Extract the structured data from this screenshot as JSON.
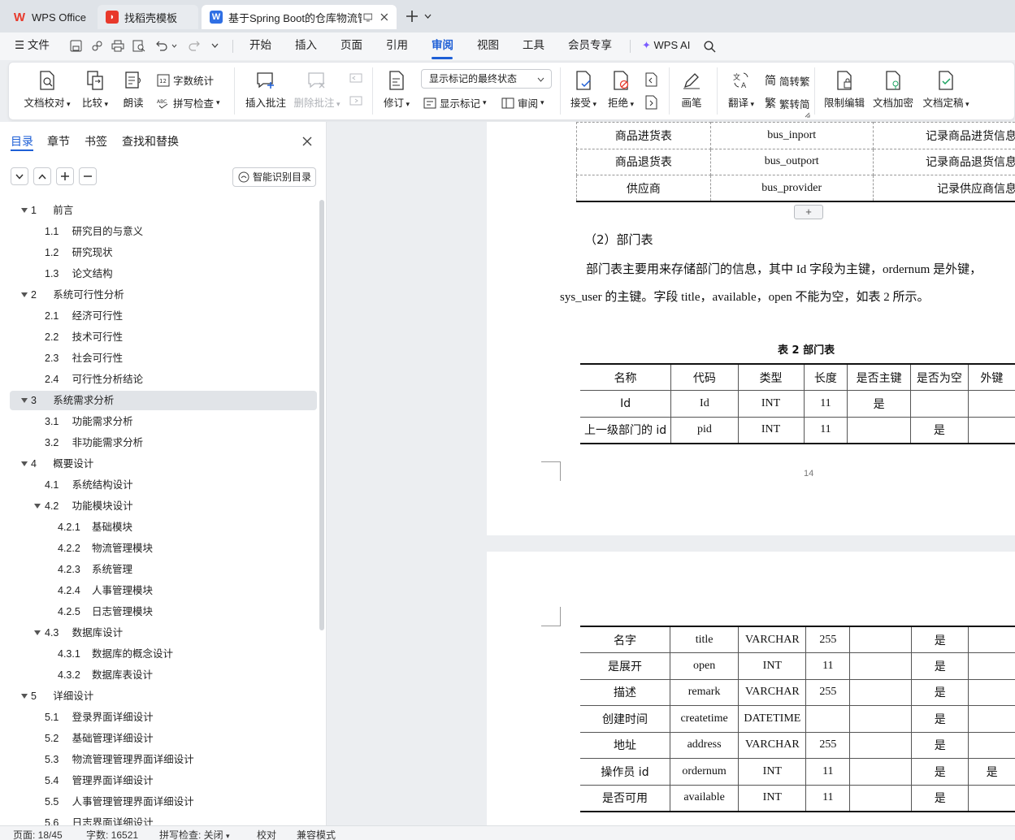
{
  "tabs": [
    {
      "label": "WPS Office",
      "icon": "wps-logo-icon"
    },
    {
      "label": "找稻壳模板",
      "icon": "docer-icon"
    },
    {
      "label": "基于Spring Boot的仓库物流管",
      "icon": "word-doc-icon"
    }
  ],
  "menu": {
    "file": "文件",
    "items": [
      "开始",
      "插入",
      "页面",
      "引用",
      "审阅",
      "视图",
      "工具",
      "会员专享"
    ],
    "active": "审阅",
    "ai": "WPS AI"
  },
  "ribbon": {
    "proof": "文档校对",
    "compare": "比较",
    "read": "朗读",
    "wordcount": "字数统计",
    "spellcheck": "拼写检查",
    "insert_comment": "插入批注",
    "delete_comment": "删除批注",
    "track": "修订",
    "display_state": "显示标记的最终状态",
    "show_markup": "显示标记",
    "review": "审阅",
    "accept": "接受",
    "reject": "拒绝",
    "pen": "画笔",
    "translate": "翻译",
    "to_traditional": "简转繁",
    "to_simplified": "繁转简",
    "restrict": "限制编辑",
    "encrypt": "文档加密",
    "finalize": "文档定稿"
  },
  "panel": {
    "tabs": [
      "目录",
      "章节",
      "书签",
      "查找和替换"
    ],
    "active_tab": "目录",
    "smart_toc": "智能识别目录",
    "toc": [
      {
        "num": "1",
        "title": "前言",
        "level": 1,
        "expanded": true
      },
      {
        "num": "1.1",
        "title": "研究目的与意义",
        "level": 2
      },
      {
        "num": "1.2",
        "title": "研究现状",
        "level": 2
      },
      {
        "num": "1.3",
        "title": "论文结构",
        "level": 2
      },
      {
        "num": "2",
        "title": "系统可行性分析",
        "level": 1,
        "expanded": true
      },
      {
        "num": "2.1",
        "title": "经济可行性",
        "level": 2
      },
      {
        "num": "2.2",
        "title": "技术可行性",
        "level": 2
      },
      {
        "num": "2.3",
        "title": "社会可行性",
        "level": 2
      },
      {
        "num": "2.4",
        "title": "可行性分析结论",
        "level": 2
      },
      {
        "num": "3",
        "title": "系统需求分析",
        "level": 1,
        "expanded": true,
        "selected": true
      },
      {
        "num": "3.1",
        "title": "功能需求分析",
        "level": 2
      },
      {
        "num": "3.2",
        "title": "非功能需求分析",
        "level": 2
      },
      {
        "num": "4",
        "title": "概要设计",
        "level": 1,
        "expanded": true
      },
      {
        "num": "4.1",
        "title": "系统结构设计",
        "level": 2
      },
      {
        "num": "4.2",
        "title": "功能模块设计",
        "level": 2,
        "expanded": true
      },
      {
        "num": "4.2.1",
        "title": "基础模块",
        "level": 3
      },
      {
        "num": "4.2.2",
        "title": "物流管理模块",
        "level": 3
      },
      {
        "num": "4.2.3",
        "title": "系统管理",
        "level": 3
      },
      {
        "num": "4.2.4",
        "title": "人事管理模块",
        "level": 3
      },
      {
        "num": "4.2.5",
        "title": "日志管理模块",
        "level": 3
      },
      {
        "num": "4.3",
        "title": "数据库设计",
        "level": 2,
        "expanded": true
      },
      {
        "num": "4.3.1",
        "title": "数据库的概念设计",
        "level": 3
      },
      {
        "num": "4.3.2",
        "title": "数据库表设计",
        "level": 3
      },
      {
        "num": "5",
        "title": "详细设计",
        "level": 1,
        "expanded": true
      },
      {
        "num": "5.1",
        "title": "登录界面详细设计",
        "level": 2
      },
      {
        "num": "5.2",
        "title": "基础管理详细设计",
        "level": 2
      },
      {
        "num": "5.3",
        "title": "物流管理管理界面详细设计",
        "level": 2
      },
      {
        "num": "5.4",
        "title": "管理界面详细设计",
        "level": 2
      },
      {
        "num": "5.5",
        "title": "人事管理管理界面详细设计",
        "level": 2
      },
      {
        "num": "5.6",
        "title": "日志界面详细设计",
        "level": 2
      }
    ]
  },
  "doc": {
    "top_table": [
      [
        "商品进货表",
        "bus_inport",
        "记录商品进货信息"
      ],
      [
        "商品退货表",
        "bus_outport",
        "记录商品退货信息"
      ],
      [
        "供应商",
        "bus_provider",
        "记录供应商信息"
      ]
    ],
    "add_row": "+",
    "heading": "（2）部门表",
    "para_line1": "部门表主要用来存储部门的信息，其中 Id 字段为主键，ordernum 是外键，",
    "para_line2": "sys_user 的主键。字段 title，available，open 不能为空，如表 2 所示。",
    "table_caption": "表 2  部门表",
    "dept_header": [
      "名称",
      "代码",
      "类型",
      "长度",
      "是否主键",
      "是否为空",
      "外键"
    ],
    "dept_rows_page1": [
      [
        "Id",
        "Id",
        "INT",
        "11",
        "是",
        "",
        ""
      ],
      [
        "上一级部门的 id",
        "pid",
        "INT",
        "11",
        "",
        "是",
        ""
      ]
    ],
    "page_number": "14",
    "dept_rows_page2": [
      [
        "名字",
        "title",
        "VARCHAR",
        "255",
        "",
        "是",
        ""
      ],
      [
        "是展开",
        "open",
        "INT",
        "11",
        "",
        "是",
        ""
      ],
      [
        "描述",
        "remark",
        "VARCHAR",
        "255",
        "",
        "是",
        ""
      ],
      [
        "创建时间",
        "createtime",
        "DATETIME",
        "",
        "",
        "是",
        ""
      ],
      [
        "地址",
        "address",
        "VARCHAR",
        "255",
        "",
        "是",
        ""
      ],
      [
        "操作员 id",
        "ordernum",
        "INT",
        "11",
        "",
        "是",
        "是"
      ],
      [
        "是否可用",
        "available",
        "INT",
        "11",
        "",
        "是",
        ""
      ]
    ]
  },
  "status": {
    "page": "页面: 18/45",
    "words": "字数: 16521",
    "spell": "拼写检查: 关闭",
    "proof": "校对",
    "compat": "兼容模式"
  },
  "colors": {
    "accent": "#1e5fd6",
    "wps_red": "#e8392b"
  }
}
